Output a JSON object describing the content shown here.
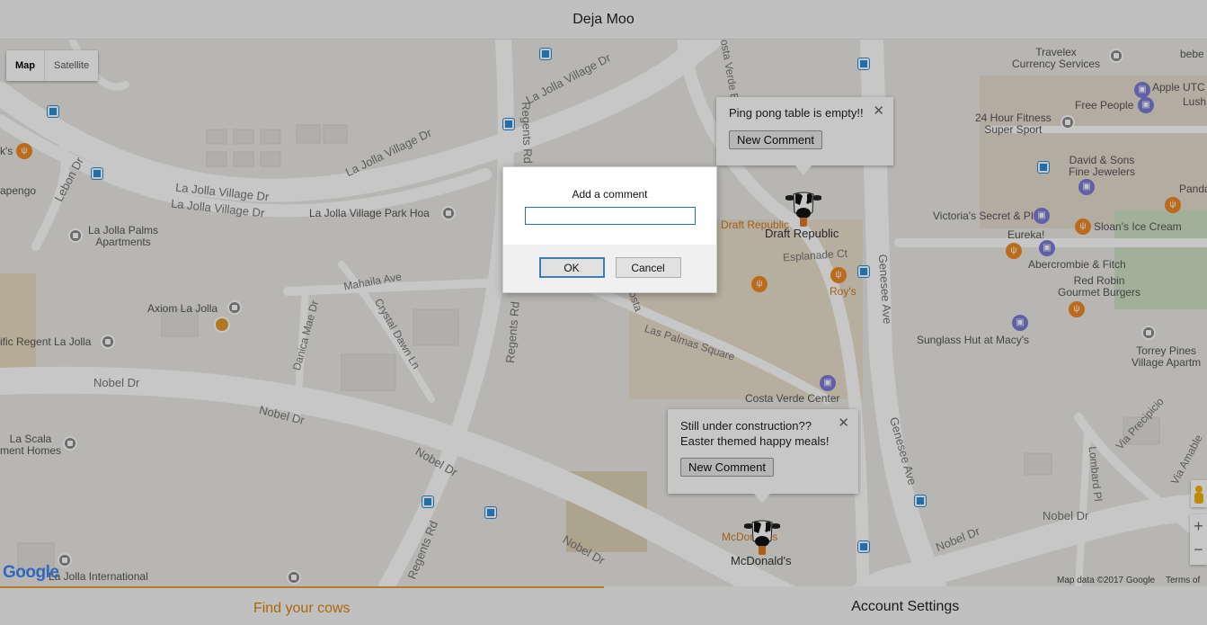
{
  "header": {
    "title": "Deja Moo"
  },
  "map": {
    "type_controls": [
      "Map",
      "Satellite"
    ],
    "labels": {
      "travelex": "Travelex\nCurrency Services",
      "bebe": "bebe",
      "apple": "Apple UTC",
      "lush": "Lush",
      "free_people": "Free People",
      "fitness": "24 Hour Fitness\nSuper Sport",
      "david_sons": "David & Sons\nFine Jewelers",
      "panda": "Panda Exp",
      "victorias": "Victoria's Secret & PINK",
      "sloans": "Sloan's Ice Cream",
      "eureka": "Eureka!",
      "abercrombie": "Abercrombie & Fitch",
      "red_robin": "Red Robin\nGourmet Burgers",
      "sunglass": "Sunglass Hut at Macy's",
      "torrey": "Torrey Pines\nVillage Apartm",
      "draft_republic_small": "Draft Republic",
      "draft_republic": "Draft Republic",
      "roys": "Roy's",
      "costa_verde": "Costa Verde Center",
      "mcdonalds_small": "McDonald's",
      "mcdonalds": "McDonald's",
      "lj_village_park": "La Jolla Village Park Hoa",
      "lj_palms": "La Jolla Palms\nApartments",
      "axiom": "Axiom La Jolla",
      "regent": "ific Regent La Jolla",
      "la_scala": "La Scala\nment Homes",
      "lj_international": "La Jolla International",
      "ks": "k's",
      "apengo": "apengo"
    },
    "streets": {
      "ljv_dr_1": "La Jolla Village Dr",
      "ljv_dr_2": "La Jolla Village Dr",
      "ljv_dr_3": "La Jolla Village Dr",
      "ljv_dr_4": "La Jolla Village Dr",
      "lebon": "Lebon Dr",
      "costa_verde_blvd": "Costa Verde Blvd",
      "regents_1": "Regents Rd",
      "regents_2": "Regents Rd",
      "regents_3": "Regents Rd",
      "esplanade": "Esplanade Ct",
      "genesee_1": "Genesee Ave",
      "genesee_2": "Genesee Ave",
      "mahaila": "Mahaila Ave",
      "crystal": "Crystal Dawn Ln",
      "danica": "Danica Mae Dr",
      "las_palmas": "Las Palmas Square",
      "costa": "Costa",
      "nobel_1": "Nobel Dr",
      "nobel_2": "Nobel Dr",
      "nobel_3": "Nobel Dr",
      "nobel_4": "Nobel Dr",
      "nobel_5": "Nobel Dr",
      "nobel_6": "Nobel Dr",
      "lombard": "Lombard Pl",
      "precipicio": "Via Precipicio",
      "amable": "Via Amable"
    },
    "attribution": "Map data ©2017 Google",
    "terms": "Terms of U",
    "google_logo": "Google"
  },
  "infowindows": [
    {
      "text": "Ping pong table is empty!!",
      "button": "New Comment"
    },
    {
      "text": "Still under construction??\nEaster themed happy meals!",
      "button": "New Comment"
    }
  ],
  "dialog": {
    "prompt": "Add a comment",
    "input_value": "",
    "ok": "OK",
    "cancel": "Cancel"
  },
  "bottom_nav": {
    "tab1": "Find your cows",
    "tab2": "Account Settings"
  },
  "colors": {
    "accent": "#d9860f",
    "map_bg": "#ebe9e4",
    "road": "#ffffff",
    "poi_orange": "#f08a24",
    "poi_purple": "#7b7bd8",
    "transit": "#2a8fd8"
  }
}
